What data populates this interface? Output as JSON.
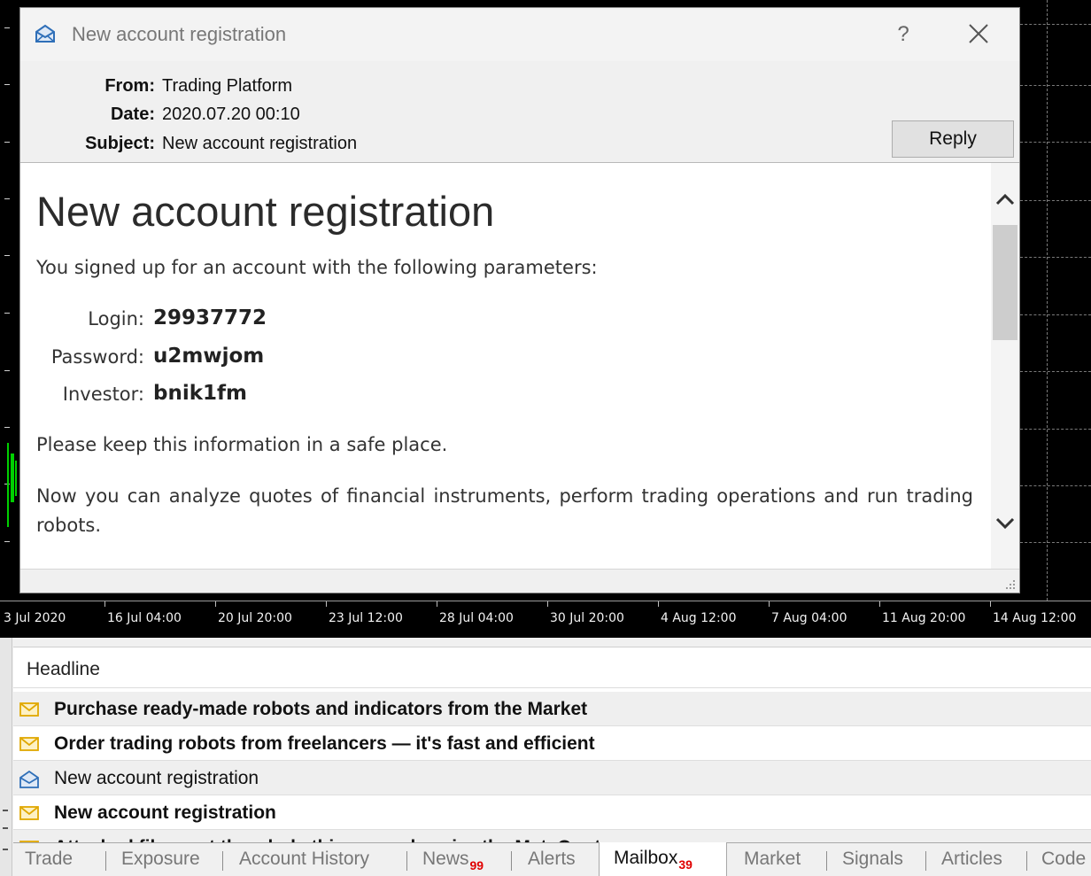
{
  "dialog": {
    "title": "New account registration",
    "help_label": "?",
    "header": {
      "from_label": "From:",
      "from_value": "Trading Platform",
      "date_label": "Date:",
      "date_value": "2020.07.20 00:10",
      "subject_label": "Subject:",
      "subject_value": "New account registration"
    },
    "reply_label": "Reply",
    "message": {
      "heading": "New account registration",
      "intro": "You signed up for an account with the following parameters:",
      "credentials": [
        {
          "label": "Login:",
          "value": "29937772"
        },
        {
          "label": "Password:",
          "value": "u2mwjom"
        },
        {
          "label": "Investor:",
          "value": "bnik1fm"
        }
      ],
      "safe_note": "Please keep this information in a safe place.",
      "closing": "Now you can analyze quotes of financial instruments, perform trading operations and run trading robots."
    }
  },
  "chart_axis": {
    "time_labels": [
      "3 Jul 2020",
      "16 Jul 04:00",
      "20 Jul 20:00",
      "23 Jul 12:00",
      "28 Jul 04:00",
      "30 Jul 20:00",
      "4 Aug 12:00",
      "7 Aug 04:00",
      "11 Aug 20:00",
      "14 Aug 12:00"
    ]
  },
  "mailbox": {
    "column_header": "Headline",
    "rows": [
      {
        "text": "Purchase ready-made robots and indicators from the Market",
        "unread": true
      },
      {
        "text": "Order trading robots from freelancers — it's fast and efficient",
        "unread": true
      },
      {
        "text": "New account registration",
        "unread": false
      },
      {
        "text": "New account registration",
        "unread": true
      },
      {
        "text": "Attached files: get the whole thing: synchronize the MetaQuotes...",
        "unread": true
      }
    ]
  },
  "tabs": [
    {
      "label": "Trade",
      "badge": ""
    },
    {
      "label": "Exposure",
      "badge": ""
    },
    {
      "label": "Account History",
      "badge": ""
    },
    {
      "label": "News",
      "badge": "99"
    },
    {
      "label": "Alerts",
      "badge": ""
    },
    {
      "label": "Mailbox",
      "badge": "39",
      "active": true
    },
    {
      "label": "Market",
      "badge": ""
    },
    {
      "label": "Signals",
      "badge": ""
    },
    {
      "label": "Articles",
      "badge": ""
    },
    {
      "label": "Code Base",
      "badge": ""
    }
  ],
  "colors": {
    "chart_background": "#000000",
    "candle_green": "#00d000",
    "badge_red": "#e00000",
    "read_mail_icon": "#2f6fb8",
    "unread_mail_icon": "#e0a800"
  },
  "icons": {
    "title": "open-envelope-icon",
    "close": "close-icon",
    "scroll_up": "chevron-up-icon",
    "scroll_down": "chevron-down-icon",
    "read_mail": "open-envelope-icon",
    "unread_mail": "closed-envelope-icon"
  }
}
